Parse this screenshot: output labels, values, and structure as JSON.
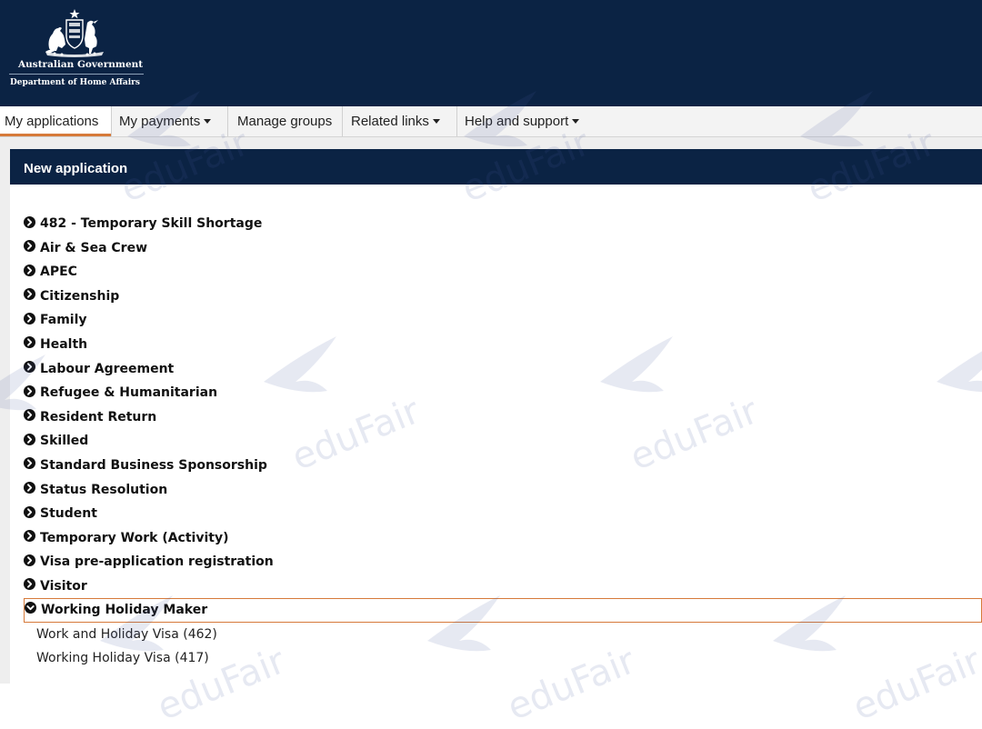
{
  "header": {
    "gov_name": "Australian Government",
    "department": "Department of Home Affairs",
    "background": "#0b2344"
  },
  "nav": {
    "items": [
      {
        "label": "My applications",
        "active": true,
        "dropdown": false
      },
      {
        "label": "My payments",
        "active": false,
        "dropdown": true
      },
      {
        "label": "Manage groups",
        "active": false,
        "dropdown": false
      },
      {
        "label": "Related links",
        "active": false,
        "dropdown": true
      },
      {
        "label": "Help and support",
        "active": false,
        "dropdown": true
      }
    ],
    "accent": "#d67a3a"
  },
  "panel": {
    "title": "New application"
  },
  "categories": [
    {
      "label": "482 - Temporary Skill Shortage"
    },
    {
      "label": "Air & Sea Crew"
    },
    {
      "label": "APEC"
    },
    {
      "label": "Citizenship"
    },
    {
      "label": "Family"
    },
    {
      "label": "Health"
    },
    {
      "label": "Labour Agreement"
    },
    {
      "label": "Refugee & Humanitarian"
    },
    {
      "label": "Resident Return"
    },
    {
      "label": "Skilled"
    },
    {
      "label": "Standard Business Sponsorship"
    },
    {
      "label": "Status Resolution"
    },
    {
      "label": "Student"
    },
    {
      "label": "Temporary Work (Activity)"
    },
    {
      "label": "Visa pre-application registration"
    },
    {
      "label": "Visitor"
    },
    {
      "label": "Working Holiday Maker",
      "expanded": true
    }
  ],
  "sub_items": [
    {
      "label": "Work and Holiday Visa (462)"
    },
    {
      "label": "Working Holiday Visa (417)"
    }
  ],
  "watermark": {
    "text": "eduFair"
  }
}
